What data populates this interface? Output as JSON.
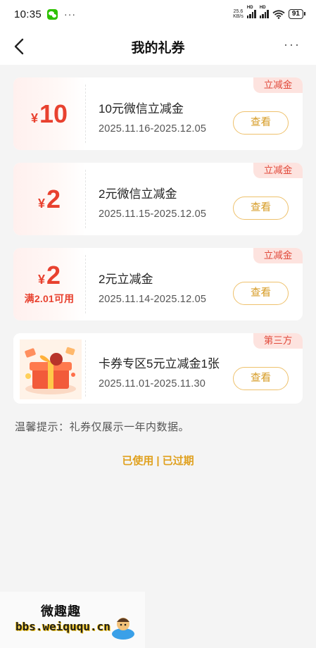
{
  "status_bar": {
    "time": "10:35",
    "more": "···",
    "net_speed_value": "25.6",
    "net_speed_unit": "KB/s",
    "signal_label": "HD",
    "battery": "91"
  },
  "header": {
    "title": "我的礼券",
    "more": "···"
  },
  "coupons": [
    {
      "currency": "¥",
      "amount": "10",
      "condition": "",
      "name": "10元微信立减金",
      "date_range": "2025.11.16-2025.12.05",
      "tag": "立减金",
      "action": "查看"
    },
    {
      "currency": "¥",
      "amount": "2",
      "condition": "",
      "name": "2元微信立减金",
      "date_range": "2025.11.15-2025.12.05",
      "tag": "立减金",
      "action": "查看"
    },
    {
      "currency": "¥",
      "amount": "2",
      "condition": "满2.01可用",
      "name": "2元立减金",
      "date_range": "2025.11.14-2025.12.05",
      "tag": "立减金",
      "action": "查看"
    },
    {
      "name": "卡券专区5元立减金1张",
      "date_range": "2025.11.01-2025.11.30",
      "tag": "第三方",
      "action": "查看"
    }
  ],
  "tip": "温馨提示：礼券仅展示一年内数据。",
  "history_links": {
    "used": "已使用",
    "separator": "|",
    "expired": "已过期"
  },
  "watermark": {
    "title": "微趣趣",
    "url": "bbs.weiququ.cn"
  },
  "colors": {
    "accent_red": "#e8412f",
    "button_gold": "#d69a22",
    "tag_bg": "#fde3df",
    "background": "#f4f4f4"
  }
}
